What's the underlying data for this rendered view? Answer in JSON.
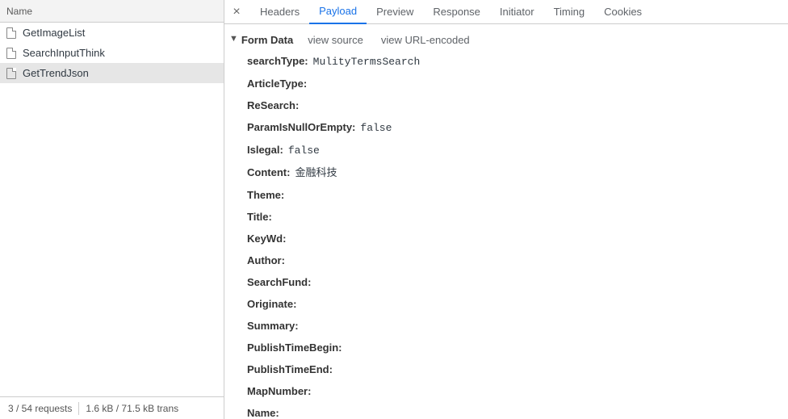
{
  "leftHeader": {
    "name": "Name"
  },
  "requests": [
    {
      "label": "GetImageList"
    },
    {
      "label": "SearchInputThink"
    },
    {
      "label": "GetTrendJson"
    }
  ],
  "selectedIndex": 2,
  "statusBar": {
    "requests": "3 / 54 requests",
    "transfer": "1.6 kB / 71.5 kB trans"
  },
  "tabs": {
    "headers": "Headers",
    "payload": "Payload",
    "preview": "Preview",
    "response": "Response",
    "initiator": "Initiator",
    "timing": "Timing",
    "cookies": "Cookies"
  },
  "section": {
    "title": "Form Data",
    "viewSource": "view source",
    "viewUrlEncoded": "view URL-encoded"
  },
  "formData": [
    {
      "key": "searchType",
      "val": "MulityTermsSearch"
    },
    {
      "key": "ArticleType",
      "val": ""
    },
    {
      "key": "ReSearch",
      "val": ""
    },
    {
      "key": "ParamIsNullOrEmpty",
      "val": "false"
    },
    {
      "key": "Islegal",
      "val": "false"
    },
    {
      "key": "Content",
      "val": "金融科技"
    },
    {
      "key": "Theme",
      "val": ""
    },
    {
      "key": "Title",
      "val": ""
    },
    {
      "key": "KeyWd",
      "val": ""
    },
    {
      "key": "Author",
      "val": ""
    },
    {
      "key": "SearchFund",
      "val": ""
    },
    {
      "key": "Originate",
      "val": ""
    },
    {
      "key": "Summary",
      "val": ""
    },
    {
      "key": "PublishTimeBegin",
      "val": ""
    },
    {
      "key": "PublishTimeEnd",
      "val": ""
    },
    {
      "key": "MapNumber",
      "val": ""
    },
    {
      "key": "Name",
      "val": ""
    }
  ]
}
